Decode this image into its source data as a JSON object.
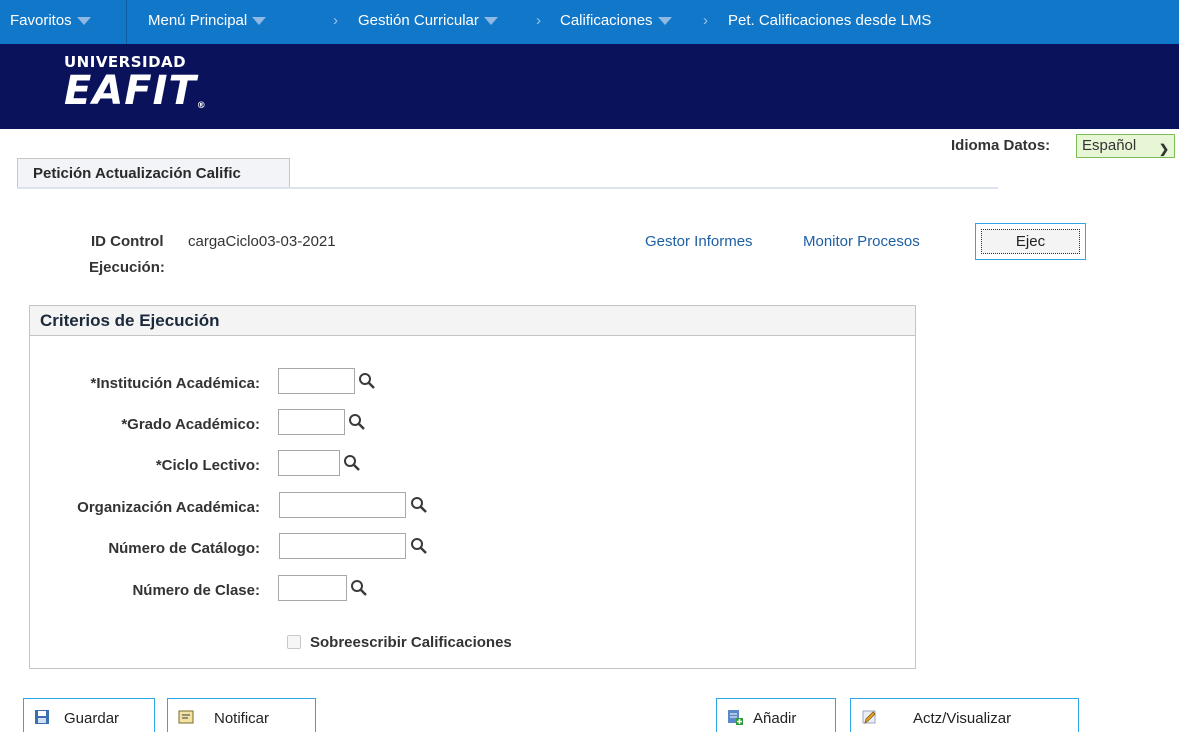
{
  "nav": {
    "favorites": "Favoritos",
    "main_menu": "Menú Principal",
    "breadcrumb_1": "Gestión Curricular",
    "breadcrumb_2": "Calificaciones",
    "breadcrumb_3": "Pet. Calificaciones desde LMS"
  },
  "banner": {
    "logo_line1": "UNIVERSIDAD",
    "logo_line2": "EAFIT",
    "logo_mark": "®"
  },
  "language": {
    "label": "Idioma Datos:",
    "selected": "Español"
  },
  "tab": {
    "label": "Petición Actualización Calific"
  },
  "run_control": {
    "label_line1": "ID Control",
    "label_line2": "Ejecución:",
    "value": "cargaCiclo03-03-2021",
    "report_manager": "Gestor Informes",
    "process_monitor": "Monitor Procesos",
    "run_button": "Ejec"
  },
  "criteria": {
    "title": "Criterios de Ejecución",
    "fields": [
      {
        "label": "*Institución Académica:",
        "value": ""
      },
      {
        "label": "*Grado Académico:",
        "value": ""
      },
      {
        "label": "*Ciclo Lectivo:",
        "value": ""
      },
      {
        "label": "Organización Académica:",
        "value": ""
      },
      {
        "label": "Número de Catálogo:",
        "value": ""
      },
      {
        "label": "Número de Clase:",
        "value": ""
      }
    ],
    "overwrite_checkbox": {
      "label": "Sobreescribir Calificaciones",
      "checked": false
    }
  },
  "toolbar": {
    "save": "Guardar",
    "notify": "Notificar",
    "add": "Añadir",
    "update_display": "Actz/Visualizar"
  },
  "colors": {
    "nav_bg": "#1177c9",
    "banner_bg": "#09125a",
    "link": "#1d5fa5",
    "button_border": "#2ea5e5",
    "language_bg": "#e7f6d5"
  }
}
